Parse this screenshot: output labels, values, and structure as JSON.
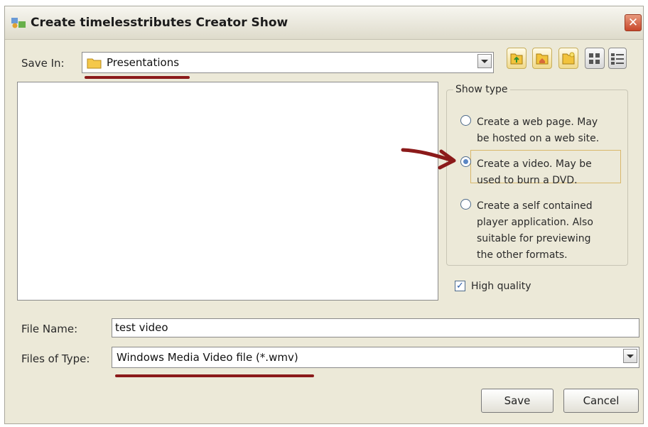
{
  "title": "Create timelesstributes Creator Show",
  "close_glyph": "✕",
  "save_in": {
    "label": "Save In:",
    "value": "Presentations"
  },
  "toolbar_icons": [
    "up-folder-icon",
    "home-folder-icon",
    "new-folder-icon",
    "list-view-icon",
    "details-view-icon"
  ],
  "show_type": {
    "title": "Show type",
    "options": [
      {
        "lines": [
          "Create a web page. May",
          "be hosted on a web site."
        ],
        "selected": false
      },
      {
        "lines": [
          "Create a video. May be",
          "used to burn a DVD."
        ],
        "selected": true
      },
      {
        "lines": [
          "Create a self contained",
          "player application. Also",
          "suitable for previewing",
          "the other formats."
        ],
        "selected": false
      }
    ]
  },
  "high_quality": {
    "label": "High quality",
    "checked": true,
    "glyph": "✓"
  },
  "file_name": {
    "label": "File Name:",
    "value": "test video"
  },
  "file_type": {
    "label": "Files of Type:",
    "value": "Windows Media Video file (*.wmv)"
  },
  "buttons": {
    "save": "Save",
    "cancel": "Cancel"
  },
  "colors": {
    "annotation": "#8b1a1a",
    "dialog_bg": "#ece9d8"
  }
}
